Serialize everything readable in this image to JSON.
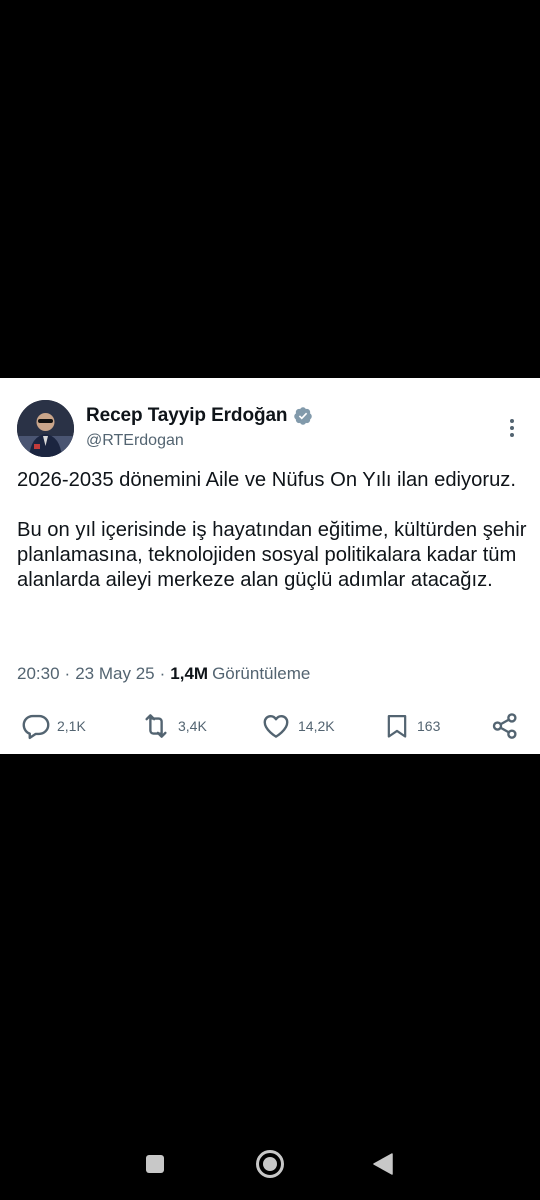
{
  "tweet": {
    "author": {
      "display_name": "Recep Tayyip Erdoğan",
      "handle": "@RTErdogan",
      "verified": true,
      "avatar_icon": "profile-photo"
    },
    "text": "2026-2035 dönemini Aile ve Nüfus On Yılı ilan ediyoruz.\n\nBu on yıl içerisinde iş hayatından eğitime, kültürden şehir planlamasına, teknolojiden sosyal politikalara kadar tüm alanlarda aileyi merkeze alan güçlü adımlar atacağız.",
    "time": "20:30",
    "date": "23 May 25",
    "views_count": "1,4M",
    "views_label": "Görüntüleme",
    "separator": "·",
    "actions": {
      "replies": "2,1K",
      "retweets": "3,4K",
      "likes": "14,2K",
      "bookmarks": "163"
    }
  },
  "colors": {
    "text_primary": "#0f1419",
    "text_secondary": "#536471",
    "verified_badge": "#829aab",
    "background": "#000000",
    "card": "#ffffff"
  },
  "system_nav": {
    "icons": [
      "recent-apps-icon",
      "home-icon",
      "back-icon"
    ]
  }
}
